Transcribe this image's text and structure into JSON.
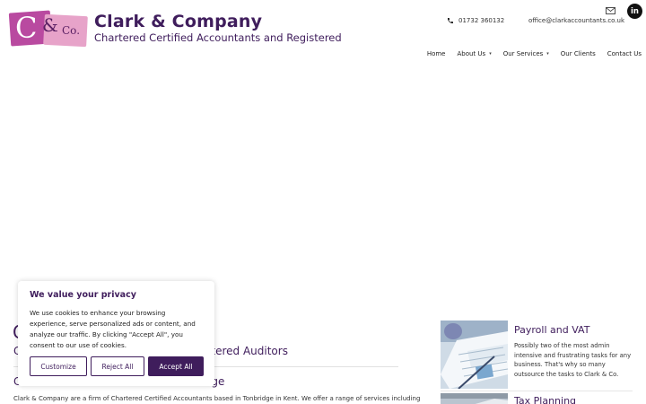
{
  "header": {
    "logo": {
      "letter": "C",
      "amp": "&",
      "co": "Co."
    },
    "brand_name": "Clark & Company",
    "tagline": "Chartered Certified Accountants and Registered",
    "phone": "01732 360132",
    "email": "office@clarkaccountants.co.uk",
    "linkedin_label": "in"
  },
  "nav": {
    "items": [
      {
        "label": "Home"
      },
      {
        "label": "About Us",
        "caret": "▾"
      },
      {
        "label": "Our Services",
        "caret": "▾"
      },
      {
        "label": "Our Clients"
      },
      {
        "label": "Contact Us"
      }
    ]
  },
  "main": {
    "title_fragment": "C",
    "subheading_left": "C",
    "subheading_right": "tered Auditors",
    "section_heading_left": "C",
    "section_heading_right": "ge",
    "body_text": "Clark & Company are a firm of Chartered Certified Accountants based in Tonbridge in Kent. We offer a range of services including"
  },
  "cookie": {
    "title": "We value your privacy",
    "text": "We use cookies to enhance your browsing experience, serve personalized ads or content, and analyze our traffic. By clicking \"Accept All\", you consent to our use of cookies.",
    "customize": "Customize",
    "reject": "Reject All",
    "accept": "Accept All"
  },
  "sidebar_cards": [
    {
      "title": "Payroll and VAT",
      "text": "Possibly two of the most admin intensive and frustrating tasks for any business. That's why so many outsource the tasks to Clark & Co."
    },
    {
      "title": "Tax Planning"
    }
  ],
  "colors": {
    "brand": "#3f1d5c",
    "logo_magenta": "#b94aa0",
    "logo_pink": "#e7a3c9"
  }
}
